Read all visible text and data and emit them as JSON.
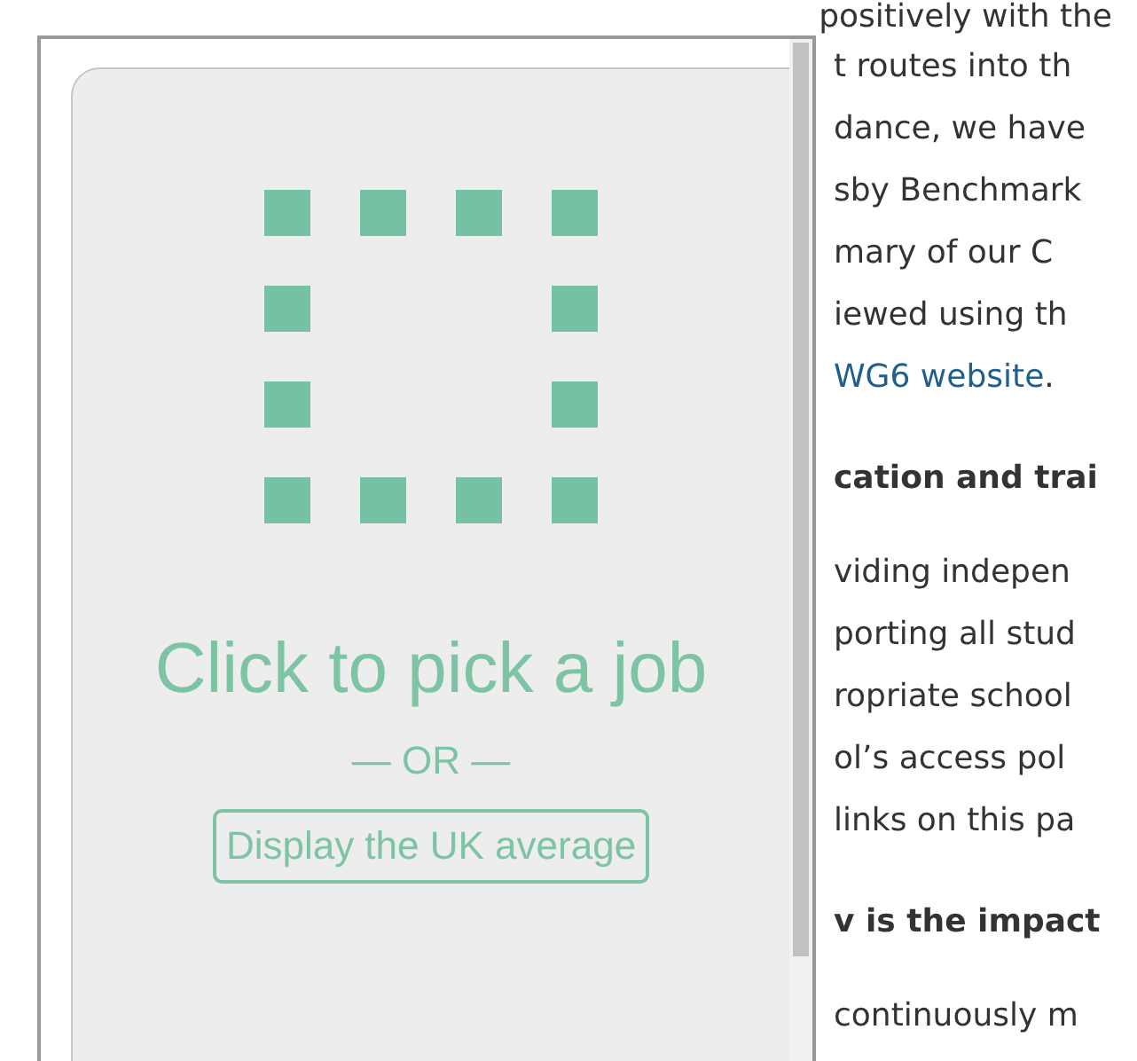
{
  "job_picker": {
    "prompt": "Click to pick a job",
    "separator": "— OR —",
    "button": "Display the UK average"
  },
  "article": {
    "top_line": "positively with the",
    "lines": [
      {
        "kind": "text",
        "text": "t routes into th"
      },
      {
        "kind": "text",
        "text": "dance, we have"
      },
      {
        "kind": "text",
        "text": "sby Benchmark"
      },
      {
        "kind": "text",
        "text": "mary of our C"
      },
      {
        "kind": "text",
        "text": "iewed using th"
      },
      {
        "kind": "link",
        "text": "WG6 website",
        "after": "."
      },
      {
        "kind": "heading",
        "text": "cation and trai"
      },
      {
        "kind": "text",
        "text": "viding indepen"
      },
      {
        "kind": "text",
        "text": "porting all stud"
      },
      {
        "kind": "text",
        "text": "ropriate school"
      },
      {
        "kind": "text",
        "text": "ol’s access pol"
      },
      {
        "kind": "text",
        "text": "links on this pa"
      },
      {
        "kind": "heading",
        "text": "v is the impact"
      },
      {
        "kind": "text",
        "text": "continuously m"
      }
    ]
  }
}
